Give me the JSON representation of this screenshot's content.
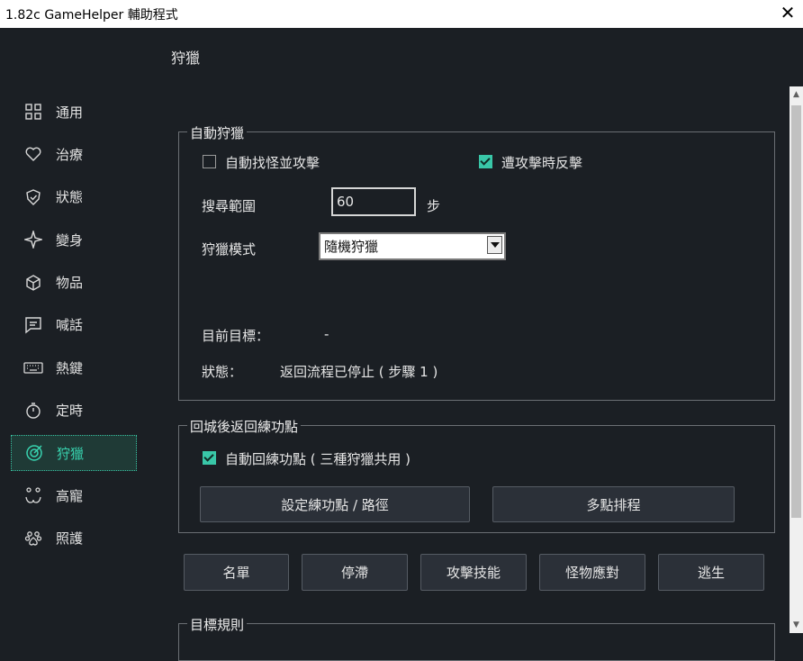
{
  "window": {
    "title": "1.82c GameHelper 輔助程式",
    "close_glyph": "✕"
  },
  "page_title": "狩獵",
  "sidebar": {
    "items": [
      {
        "label": "通用",
        "icon": "grid-icon"
      },
      {
        "label": "治療",
        "icon": "heart-icon"
      },
      {
        "label": "狀態",
        "icon": "shield-icon"
      },
      {
        "label": "變身",
        "icon": "sparkle-icon"
      },
      {
        "label": "物品",
        "icon": "cube-icon"
      },
      {
        "label": "喊話",
        "icon": "chat-icon"
      },
      {
        "label": "熱鍵",
        "icon": "keyboard-icon"
      },
      {
        "label": "定時",
        "icon": "timer-icon"
      },
      {
        "label": "狩獵",
        "icon": "target-icon",
        "active": true
      },
      {
        "label": "高寵",
        "icon": "paw-face-icon"
      },
      {
        "label": "照護",
        "icon": "paw-icon"
      }
    ]
  },
  "auto_hunt": {
    "legend": "自動狩獵",
    "auto_find_label": "自動找怪並攻擊",
    "auto_find_checked": false,
    "counter_label": "遭攻擊時反擊",
    "counter_checked": true,
    "search_range_label": "搜尋範圍",
    "search_range_value": "60",
    "search_range_unit": "步",
    "mode_label": "狩獵模式",
    "mode_value": "隨機狩獵",
    "target_label": "目前目標：",
    "target_value": "-",
    "status_label": "狀態：",
    "status_value": "返回流程已停止 ( 步驟 1 )"
  },
  "return_group": {
    "legend": "回城後返回練功點",
    "auto_return_label": "自動回練功點 ( 三種狩獵共用 )",
    "auto_return_checked": true,
    "set_point_button": "設定練功點 / 路徑",
    "multi_schedule_button": "多點排程"
  },
  "action_buttons": [
    "名單",
    "停滯",
    "攻擊技能",
    "怪物應對",
    "逃生"
  ],
  "target_rules": {
    "legend": "目標規則"
  },
  "colors": {
    "accent": "#39c7a8",
    "background": "#1b1f24",
    "active_bg": "#1f3a36"
  }
}
